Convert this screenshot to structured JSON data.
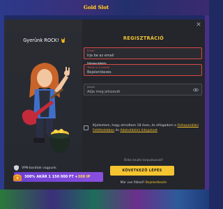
{
  "background": {
    "logo_text": "Gold Slot"
  },
  "modal": {
    "close_glyph": "✕",
    "left": {
      "title": "Gyerünk ROCK!",
      "title_emoji": "🤘",
      "vpn_text": "VPN-barátok vagyunk",
      "promo": {
        "part1": "300% AKÁR 1 150 000 FT + ",
        "part2": "300 IP"
      }
    },
    "form": {
      "title": "REGISZTRÁCIÓ",
      "email": {
        "label": "Email",
        "placeholder": "Írja be az email"
      },
      "username": {
        "label": "Töltse ki a mezőt",
        "sublabel": "Felhasználónév",
        "placeholder": "Bejelentkezés"
      },
      "password": {
        "label": "Jelszó",
        "placeholder": "Adja meg jelszavát"
      },
      "terms": {
        "text1": "Kijelentem, hogy elmúltam 18 éves, és elfogadom a",
        "link1": "Felhasználási Feltételekben",
        "text2": " és ",
        "link2": "Adatvédelmi Irányelvet"
      },
      "already_have_promo": "Önke ánulte tarpuskusoid?",
      "next_button": "KÖVETKEZŐ LÉPÉS",
      "login_prompt": "Már van fiókod? ",
      "login_link": "Bejelentkezés"
    }
  },
  "colors": {
    "accent": "#f4c431",
    "error": "#d94848",
    "promo": "#7b46d8",
    "modal_bg": "#24262b"
  }
}
